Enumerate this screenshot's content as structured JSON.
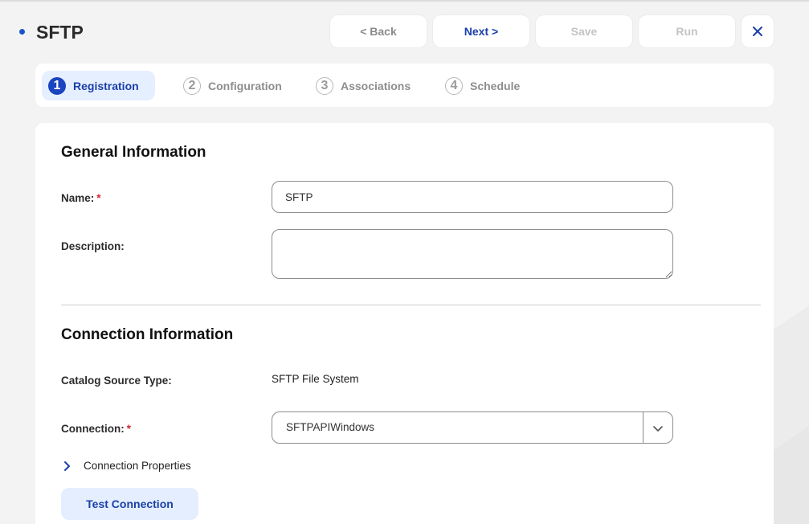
{
  "header": {
    "title": "SFTP",
    "buttons": {
      "back": "< Back",
      "next": "Next >",
      "save": "Save",
      "run": "Run"
    }
  },
  "stepper": {
    "steps": [
      {
        "number": "1",
        "label": "Registration",
        "state": "active"
      },
      {
        "number": "2",
        "label": "Configuration",
        "state": "inactive"
      },
      {
        "number": "3",
        "label": "Associations",
        "state": "inactive"
      },
      {
        "number": "4",
        "label": "Schedule",
        "state": "inactive"
      }
    ]
  },
  "general": {
    "title": "General Information",
    "name_label": "Name:",
    "name_value": "SFTP",
    "description_label": "Description:",
    "description_value": ""
  },
  "connection": {
    "title": "Connection Information",
    "source_type_label": "Catalog Source Type:",
    "source_type_value": "SFTP File System",
    "connection_label": "Connection:",
    "connection_value": "SFTPAPIWindows",
    "properties_label": "Connection Properties",
    "test_button": "Test Connection"
  },
  "required_marker": "*",
  "colors": {
    "accent": "#1a3fa8",
    "step_active_bg": "#e6efff",
    "required": "#d2222d",
    "background": "#f3f3f3"
  },
  "icons": {
    "close": "close-icon",
    "chevron_down": "chevron-down-icon",
    "chevron_right": "chevron-right-icon",
    "status_dot": "status-dot-icon"
  }
}
